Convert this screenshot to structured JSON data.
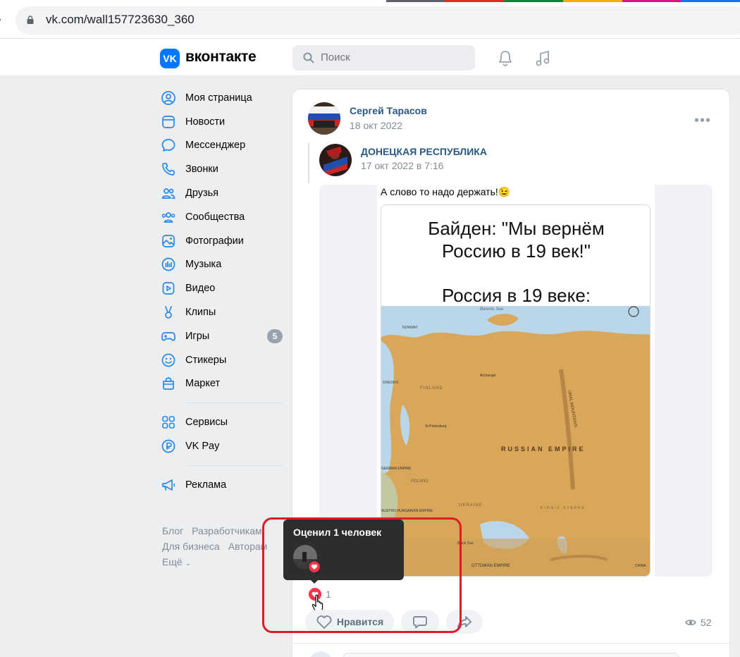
{
  "browser": {
    "url": "vk.com/wall157723630_360"
  },
  "header": {
    "logo_mark": "VK",
    "logo_text": "вконтакте",
    "search_placeholder": "Поиск"
  },
  "menu": {
    "items": [
      {
        "label": "Моя страница",
        "icon": "profile-icon"
      },
      {
        "label": "Новости",
        "icon": "news-icon"
      },
      {
        "label": "Мессенджер",
        "icon": "messenger-icon"
      },
      {
        "label": "Звонки",
        "icon": "phone-icon"
      },
      {
        "label": "Друзья",
        "icon": "friends-icon"
      },
      {
        "label": "Сообщества",
        "icon": "communities-icon"
      },
      {
        "label": "Фотографии",
        "icon": "photos-icon"
      },
      {
        "label": "Музыка",
        "icon": "music-icon"
      },
      {
        "label": "Видео",
        "icon": "video-icon"
      },
      {
        "label": "Клипы",
        "icon": "clips-icon"
      },
      {
        "label": "Игры",
        "icon": "games-icon",
        "badge": "5"
      },
      {
        "label": "Стикеры",
        "icon": "stickers-icon"
      },
      {
        "label": "Маркет",
        "icon": "market-icon"
      }
    ],
    "items2": [
      {
        "label": "Сервисы",
        "icon": "services-icon"
      },
      {
        "label": "VK Pay",
        "icon": "vkpay-icon"
      }
    ],
    "items3": [
      {
        "label": "Реклама",
        "icon": "ads-icon"
      }
    ],
    "footer": {
      "blog": "Блог",
      "developers": "Разработчикам",
      "business": "Для бизнеса",
      "authors": "Авторам",
      "more": "Ещё"
    }
  },
  "post": {
    "author": "Сергей Тарасов",
    "date": "18 окт 2022",
    "more": "•••",
    "repost": {
      "author": "ДОНЕЦКАЯ РЕСПУБЛИКА",
      "date": "17 окт 2022 в 7:16",
      "caption": "А слово то надо держать!😉"
    },
    "meme": {
      "line1": "Байден: \"Мы вернём",
      "line2": "Россию в 19 век!\"",
      "line3": "Россия в 19 веке:"
    },
    "map_labels": {
      "sea": "Barents Sea",
      "empire": "RUSSIAN EMPIRE",
      "ural": "URAL MOUNTAINS",
      "norway": "NORWAY",
      "sweden": "SWEDEN",
      "finland": "FINLAND",
      "ottoman": "OTTOMAN EMPIRE",
      "poland": "POLAND",
      "ukraine": "UKRAINE",
      "black": "Black Sea",
      "germany": "GERMAN EMPIRE",
      "austro": "AUSTRO-HUNGARIAN EMPIRE",
      "kirgiz": "KIRGIZ STEPPE",
      "china": "CHINA",
      "petersburg": "St Petersburg",
      "archangel": "Archangel"
    },
    "tooltip": {
      "title": "Оценил 1 человек"
    },
    "likes_count": "1",
    "like_label": "Нравится",
    "views": "52"
  },
  "colors": {
    "vk_blue": "#0077ff",
    "link": "#2a5885",
    "highlight_red": "#e01b24",
    "like_red": "#ff3347"
  }
}
